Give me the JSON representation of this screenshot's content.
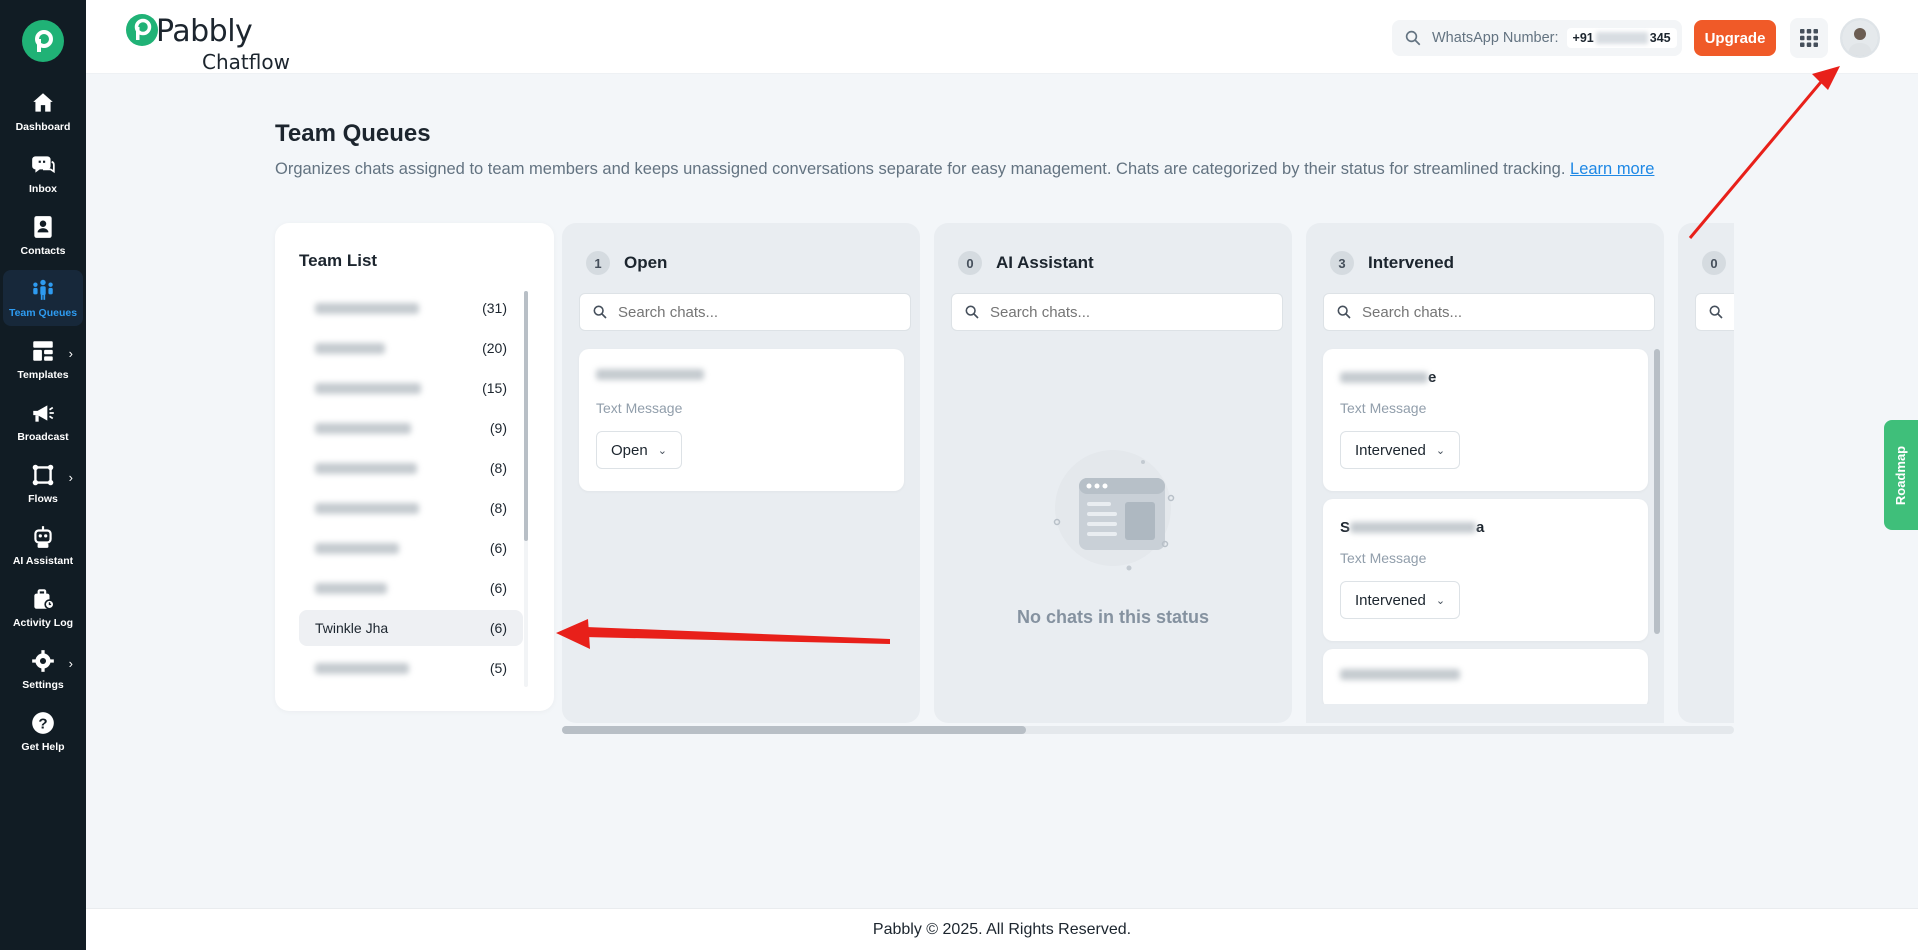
{
  "sidebar": {
    "items": [
      {
        "label": "Dashboard",
        "icon": "home-icon"
      },
      {
        "label": "Inbox",
        "icon": "chat-icon"
      },
      {
        "label": "Contacts",
        "icon": "contact-icon"
      },
      {
        "label": "Team Queues",
        "icon": "team-icon",
        "active": true
      },
      {
        "label": "Templates",
        "icon": "template-icon",
        "expandable": true
      },
      {
        "label": "Broadcast",
        "icon": "megaphone-icon"
      },
      {
        "label": "Flows",
        "icon": "flows-icon",
        "expandable": true
      },
      {
        "label": "AI Assistant",
        "icon": "robot-icon"
      },
      {
        "label": "Activity Log",
        "icon": "activity-icon"
      },
      {
        "label": "Settings",
        "icon": "gear-icon",
        "expandable": true
      },
      {
        "label": "Get Help",
        "icon": "help-icon"
      }
    ]
  },
  "header": {
    "brand_name": "Pabbly",
    "brand_sub": "Chatflow",
    "whatsapp_label": "WhatsApp Number:",
    "whatsapp_prefix": "+91",
    "whatsapp_suffix": "345",
    "upgrade_label": "Upgrade"
  },
  "page": {
    "title": "Team Queues",
    "description": "Organizes chats assigned to team members and keeps unassigned conversations separate for easy management. Chats are categorized by their status for streamlined tracking.",
    "learn_more": "Learn more"
  },
  "team_list": {
    "title": "Team List",
    "members": [
      {
        "name": "",
        "count": "(31)",
        "blur_width": 104
      },
      {
        "name": "",
        "count": "(20)",
        "blur_width": 70
      },
      {
        "name": "",
        "count": "(15)",
        "blur_width": 106
      },
      {
        "name": "",
        "count": "(9)",
        "blur_width": 96
      },
      {
        "name": "",
        "count": "(8)",
        "blur_width": 102
      },
      {
        "name": "",
        "count": "(8)",
        "blur_width": 104
      },
      {
        "name": "",
        "count": "(6)",
        "blur_width": 84
      },
      {
        "name": "",
        "count": "(6)",
        "blur_width": 72
      },
      {
        "name": "Twinkle Jha",
        "count": "(6)",
        "selected": true
      },
      {
        "name": "",
        "count": "(5)",
        "blur_width": 94
      }
    ]
  },
  "columns": [
    {
      "count": "1",
      "title": "Open",
      "search_placeholder": "Search chats...",
      "chats": [
        {
          "name_suffix": "",
          "type": "Text Message",
          "status": "Open"
        }
      ]
    },
    {
      "count": "0",
      "title": "AI Assistant",
      "search_placeholder": "Search chats...",
      "empty_text": "No chats in this status"
    },
    {
      "count": "3",
      "title": "Intervened",
      "search_placeholder": "Search chats...",
      "chats": [
        {
          "name_prefix": "",
          "name_suffix": "e",
          "type": "Text Message",
          "status": "Intervened"
        },
        {
          "name_prefix": "S",
          "name_suffix": "a",
          "type": "Text Message",
          "status": "Intervened"
        }
      ]
    },
    {
      "count": "0",
      "title": "",
      "search_placeholder": ""
    }
  ],
  "roadmap_label": "Roadmap",
  "footer": {
    "text": "Pabbly © 2025. All Rights Reserved."
  },
  "colors": {
    "sidebar_bg": "#111c24",
    "brand_green": "#20b276",
    "active_blue": "#2e9bf0",
    "upgrade_orange": "#f05a28",
    "annotation_red": "#e8201a"
  }
}
